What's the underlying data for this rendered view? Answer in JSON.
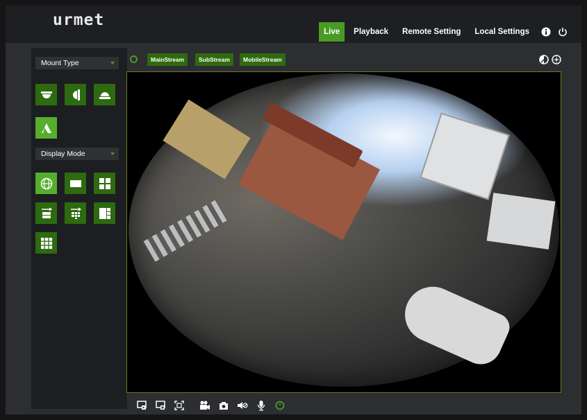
{
  "app": {
    "logo": "urmet"
  },
  "nav": {
    "items": [
      {
        "label": "Live",
        "active": true
      },
      {
        "label": "Playback"
      },
      {
        "label": "Remote Setting"
      },
      {
        "label": "Local Settings"
      }
    ],
    "info_icon": "info-icon",
    "power_icon": "power-icon"
  },
  "sidebar": {
    "mount_type": {
      "label": "Mount Type"
    },
    "mount_icons": [
      "ceiling-mount-icon",
      "wall-mount-icon",
      "table-mount-icon",
      "tilt-mount-icon"
    ],
    "display_mode": {
      "label": "Display Mode"
    },
    "display_icons": [
      "fisheye-view-icon",
      "panorama-view-icon",
      "quad-view-icon",
      "split-panorama-icon",
      "split-panorama-grid-icon",
      "one-plus-three-icon",
      "nine-grid-icon"
    ]
  },
  "streams": {
    "main": "MainStream",
    "sub": "SubStream",
    "mobile": "MobileStream"
  },
  "toolbar_top_right": [
    "color-adjust-icon",
    "ptz-control-icon"
  ],
  "bottom_toolbar": [
    "open-all-icon",
    "close-all-icon",
    "fullscreen-icon",
    "record-icon",
    "snapshot-icon",
    "mute-icon",
    "talk-icon",
    "refresh-icon"
  ],
  "colors": {
    "accent": "#4a9b24",
    "accent_dark": "#2e6a10",
    "background": "#2c2e32"
  }
}
